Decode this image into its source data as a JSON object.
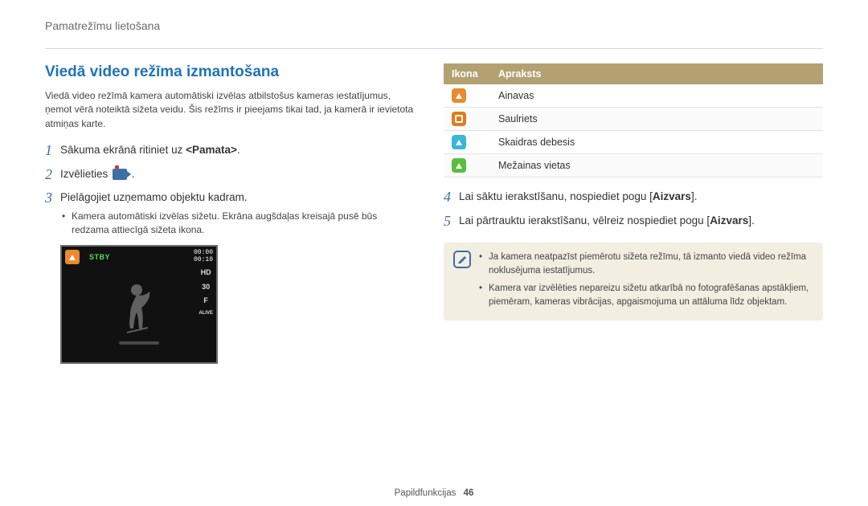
{
  "header": "Pamatrežīmu lietošana",
  "title": "Viedā video režīma izmantošana",
  "intro": "Viedā video režīmā kamera automātiski izvēlas atbilstošus kameras iestatījumus, ņemot vērā noteiktā sižeta veidu. Šis režīms ir pieejams tikai tad, ja kamerā ir ievietota atmiņas karte.",
  "steps_left": [
    {
      "n": "1",
      "text_pre": "Sākuma ekrānā ritiniet uz ",
      "bold": "<Pamata>",
      "text_post": "."
    },
    {
      "n": "2",
      "text_pre": "Izvēlieties ",
      "icon": "smart-video-icon",
      "text_post": " ."
    },
    {
      "n": "3",
      "text_pre": "Pielāgojiet uzņemamo objektu kadram.",
      "sub": "Kamera automātiski izvēlas sižetu. Ekrāna augšdaļas kreisajā pusē būs redzama attiecīgā sižeta ikona."
    }
  ],
  "steps_right": [
    {
      "n": "4",
      "text_pre": "Lai sāktu ierakstīšanu, nospiediet pogu [",
      "bold": "Aizvars",
      "text_post": "]."
    },
    {
      "n": "5",
      "text_pre": "Lai pārtrauktu ierakstīšanu, vēlreiz nospiediet pogu [",
      "bold": "Aizvars",
      "text_post": "]."
    }
  ],
  "table": {
    "head": {
      "icon": "Ikona",
      "desc": "Apraksts"
    },
    "rows": [
      {
        "icon_class": "sq-orange",
        "glyph": "triangle",
        "label": "Ainavas"
      },
      {
        "icon_class": "sq-orange2",
        "glyph": "box",
        "label": "Saulriets"
      },
      {
        "icon_class": "sq-sky",
        "glyph": "triangle",
        "label": "Skaidras debesis"
      },
      {
        "icon_class": "sq-green",
        "glyph": "triangle",
        "label": "Mežainas vietas"
      }
    ]
  },
  "notes": [
    "Ja kamera neatpazīst piemērotu sižeta režīmu, tā izmanto viedā video režīma noklusējuma iestatījumus.",
    "Kamera var izvēlēties nepareizu sižetu atkarībā no fotografēšanas apstākļiem, piemēram, kameras vibrācijas, apgaismojuma un attāluma līdz objektam."
  ],
  "screenshot": {
    "mode_icon": "landscape-icon",
    "stby": "STBY",
    "time_top": "00:00",
    "time_bottom": "00:10",
    "right_labels": [
      "HD",
      "30",
      "F",
      "ALIVE"
    ]
  },
  "footer": {
    "section": "Papildfunkcijas",
    "page": "46"
  }
}
